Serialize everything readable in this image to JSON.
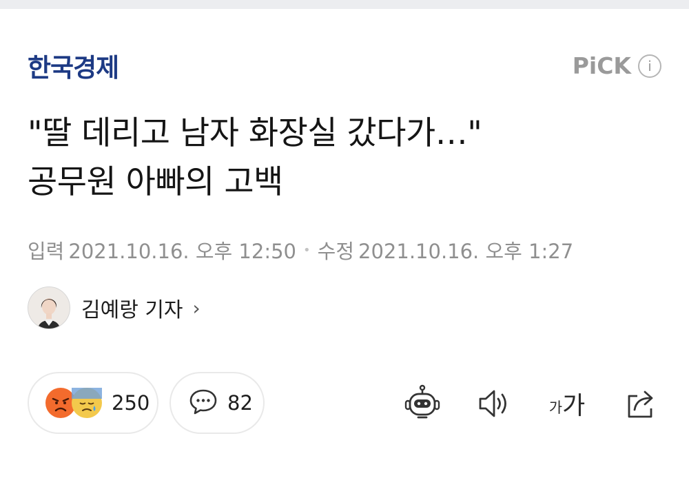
{
  "press": {
    "name": "한국경제",
    "pick_label": "PiCK",
    "info_glyph": "i"
  },
  "article": {
    "headline_line1": "\"딸 데리고 남자 화장실 갔다가…\"",
    "headline_line2": "공무원 아빠의 고백",
    "input_label": "입력",
    "input_time": "2021.10.16. 오후 12:50",
    "modified_label": "수정",
    "modified_time": "2021.10.16. 오후 1:27"
  },
  "reporter": {
    "name": "김예랑 기자",
    "chevron": "›"
  },
  "reactions": {
    "count": "250",
    "emojis": [
      "angry-emoji",
      "sad-emoji"
    ]
  },
  "comments": {
    "count": "82"
  },
  "toolbar": {
    "font_small": "가",
    "font_big": "가",
    "icons": [
      "robot-summary-icon",
      "speaker-icon",
      "font-size-icon",
      "share-icon"
    ]
  },
  "colors": {
    "brand": "#1d3a84",
    "muted": "#8f8f8f",
    "angry": "#f36b2d",
    "sad": "#f3c94c"
  }
}
